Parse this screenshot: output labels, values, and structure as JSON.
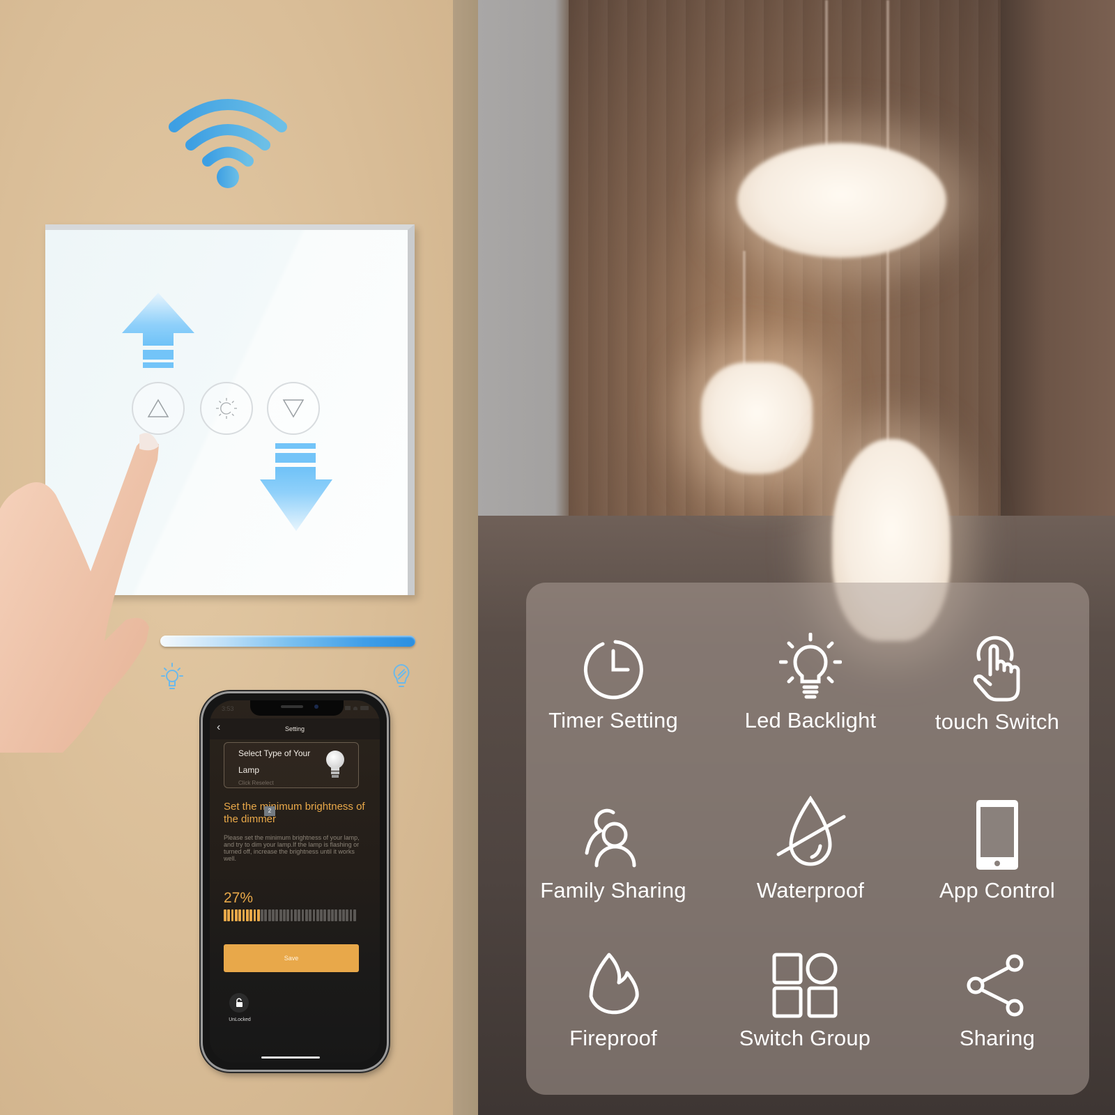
{
  "scene": {
    "colors": {
      "wall": "#d9bd97",
      "switch_accent": "#6fc2f7",
      "app_accent": "#e8a849",
      "panel_overlay": "#aca098"
    }
  },
  "switch_panel": {
    "buttons": [
      {
        "name": "up",
        "icon": "triangle-up-icon"
      },
      {
        "name": "brightness",
        "icon": "sun-icon"
      },
      {
        "name": "down",
        "icon": "triangle-down-icon"
      }
    ]
  },
  "dimmer": {
    "min_icon": "bulb-bright-icon",
    "max_icon": "bulb-dim-icon"
  },
  "phone": {
    "status_time": "3:53",
    "nav_title": "Setting",
    "lamp_card": {
      "line1": "Select Type of Your",
      "line2": "Lamp",
      "hint": "Click Reselect"
    },
    "dimmer_title": "Set the minimum brightness of the dimmer",
    "badge": "2",
    "dimmer_description": "Please set the minimum brightness of your lamp, and try to dim your lamp.If the lamp is flashing or turned off, increase the brightness until it works well.",
    "brightness_percent_label": "27%",
    "brightness_value": 27,
    "save_label": "Save",
    "lock_label": "UnLocked"
  },
  "features": [
    {
      "label": "Timer Setting",
      "icon": "clock-icon"
    },
    {
      "label": "Led Backlight",
      "icon": "lightbulb-icon"
    },
    {
      "label": "touch Switch",
      "icon": "touch-hand-icon"
    },
    {
      "label": "Family Sharing",
      "icon": "users-icon"
    },
    {
      "label": "Waterproof",
      "icon": "water-drop-icon"
    },
    {
      "label": "App Control",
      "icon": "smartphone-icon"
    },
    {
      "label": "Fireproof",
      "icon": "flame-icon"
    },
    {
      "label": "Switch Group",
      "icon": "grid-icon"
    },
    {
      "label": "Sharing",
      "icon": "share-icon"
    }
  ]
}
